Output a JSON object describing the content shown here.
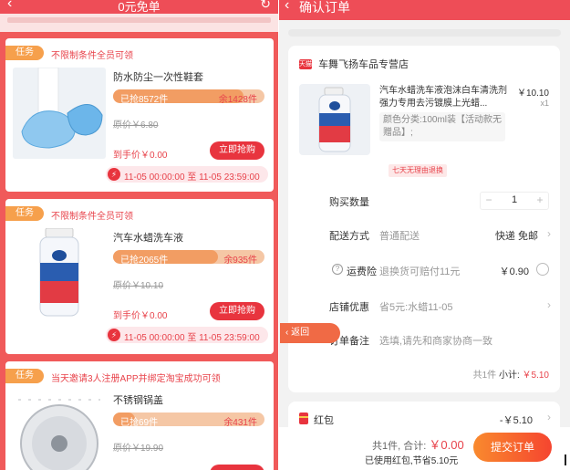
{
  "left": {
    "title": "0元免单",
    "back_icon": "chevron-left-icon",
    "refresh_icon": "refresh-icon",
    "cards": [
      {
        "tag": "任务",
        "condition": "不限制条件全员可领",
        "name": "防水防尘一次性鞋套",
        "sold": "已抢8572件",
        "remaining": "余1428件",
        "sold_fraction": 0.86,
        "original": "原价￥6.80",
        "hand_price": "到手价￥0.00",
        "buy": "立即抢购",
        "time": "11-05 00:00:00 至 11-05 23:59:00"
      },
      {
        "tag": "任务",
        "condition": "不限制条件全员可领",
        "name": "汽车水蜡洗车液",
        "sold": "已抢2065件",
        "remaining": "余935件",
        "sold_fraction": 0.69,
        "original": "原价￥10.10",
        "hand_price": "到手价￥0.00",
        "buy": "立即抢购",
        "time": "11-05 00:00:00 至 11-05 23:59:00"
      },
      {
        "tag": "任务",
        "condition": "当天邀请3人注册APP并绑定淘宝成功可领",
        "name": "不锈钢锅盖",
        "sold": "已抢69件",
        "remaining": "余431件",
        "sold_fraction": 0.14,
        "original": "原价￥19.90",
        "hand_price": "",
        "buy": "",
        "time": ""
      }
    ]
  },
  "right": {
    "title": "确认订单",
    "shop": {
      "badge": "天猫",
      "name": "车舞飞扬车品专营店"
    },
    "product": {
      "title": "汽车水蜡洗车液泡沫白车清洗剂强力专用去污镀膜上光蜡...",
      "price": "￥10.10",
      "qty": "x1",
      "spec": "颜色分类:100ml装【活动款无赠品】;",
      "refund": "七天无理由退换"
    },
    "rows": {
      "quantity_label": "购买数量",
      "quantity_value": "1",
      "delivery_label": "配送方式",
      "delivery_value": "普通配送",
      "delivery_right": "快递 免邮",
      "insurance_label": "运费险",
      "insurance_value": "退换货可赔付11元",
      "insurance_price": "￥0.90",
      "discount_label": "店铺优惠",
      "discount_value": "省5元:水蜡11-05",
      "note_label": "订单备注",
      "note_placeholder": "选填,请先和商家协商一致"
    },
    "subtotal": {
      "count": "共1件",
      "label": "小计:",
      "value": "￥5.10"
    },
    "redpacket": {
      "label": "红包",
      "value": "-￥5.10"
    },
    "bottom": {
      "count": "共1件,",
      "total_label": "合计:",
      "total_value": "￥0.00",
      "used": "已使用红包,节省5.10元",
      "submit": "提交订单"
    },
    "return_button": "返回"
  }
}
